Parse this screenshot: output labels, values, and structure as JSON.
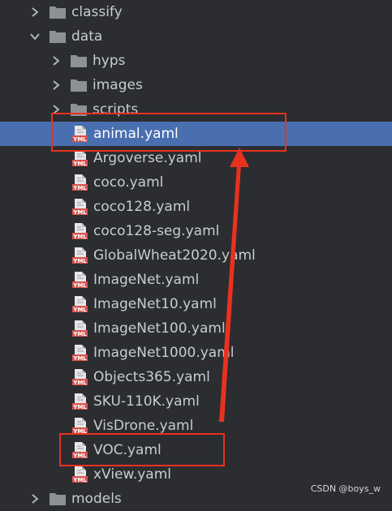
{
  "tree": {
    "items": [
      {
        "kind": "folder",
        "label": "classify",
        "expanded": false,
        "level": 0
      },
      {
        "kind": "folder",
        "label": "data",
        "expanded": true,
        "level": 0
      },
      {
        "kind": "folder",
        "label": "hyps",
        "expanded": false,
        "level": 1
      },
      {
        "kind": "folder",
        "label": "images",
        "expanded": false,
        "level": 1
      },
      {
        "kind": "folder",
        "label": "scripts",
        "expanded": false,
        "level": 1
      },
      {
        "kind": "file",
        "label": "animal.yaml",
        "selected": true,
        "level": 1
      },
      {
        "kind": "file",
        "label": "Argoverse.yaml",
        "level": 1
      },
      {
        "kind": "file",
        "label": "coco.yaml",
        "level": 1
      },
      {
        "kind": "file",
        "label": "coco128.yaml",
        "level": 1
      },
      {
        "kind": "file",
        "label": "coco128-seg.yaml",
        "level": 1
      },
      {
        "kind": "file",
        "label": "GlobalWheat2020.yaml",
        "level": 1
      },
      {
        "kind": "file",
        "label": "ImageNet.yaml",
        "level": 1
      },
      {
        "kind": "file",
        "label": "ImageNet10.yaml",
        "level": 1
      },
      {
        "kind": "file",
        "label": "ImageNet100.yaml",
        "level": 1
      },
      {
        "kind": "file",
        "label": "ImageNet1000.yaml",
        "level": 1
      },
      {
        "kind": "file",
        "label": "Objects365.yaml",
        "level": 1
      },
      {
        "kind": "file",
        "label": "SKU-110K.yaml",
        "level": 1
      },
      {
        "kind": "file",
        "label": "VisDrone.yaml",
        "level": 1
      },
      {
        "kind": "file",
        "label": "VOC.yaml",
        "level": 1
      },
      {
        "kind": "file",
        "label": "xView.yaml",
        "level": 1
      },
      {
        "kind": "folder",
        "label": "models",
        "expanded": false,
        "level": 0
      }
    ]
  },
  "file_icon_text": "YML",
  "watermark": "CSDN @boys_w",
  "colors": {
    "background": "#2b2d30",
    "selection": "#4a6fb0",
    "annotation": "#e8321f",
    "text": "#c9cccf",
    "folder": "#8c9196",
    "yml_icon": "#d9534f"
  },
  "icons": {
    "collapsed": "chevron-right-icon",
    "expanded": "chevron-down-icon",
    "folder": "folder-icon",
    "file": "yaml-file-icon"
  }
}
